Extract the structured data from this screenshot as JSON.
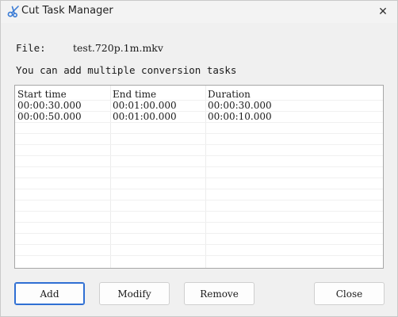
{
  "window": {
    "title": "Cut Task Manager",
    "close_glyph": "✕"
  },
  "file": {
    "label": "File:",
    "value": "test.720p.1m.mkv"
  },
  "hint": "You can add multiple conversion tasks",
  "table": {
    "columns": [
      "Start time",
      "End time",
      "Duration"
    ],
    "rows": [
      [
        "00:00:30.000",
        "00:01:00.000",
        "00:00:30.000"
      ],
      [
        "00:00:50.000",
        "00:01:00.000",
        "00:00:10.000"
      ]
    ]
  },
  "buttons": {
    "add": "Add",
    "modify": "Modify",
    "remove": "Remove",
    "close": "Close"
  },
  "icons": {
    "app": "scissors-icon",
    "close": "close-icon"
  },
  "colors": {
    "accent": "#2f6fd3",
    "icon": "#3a7bd5"
  }
}
